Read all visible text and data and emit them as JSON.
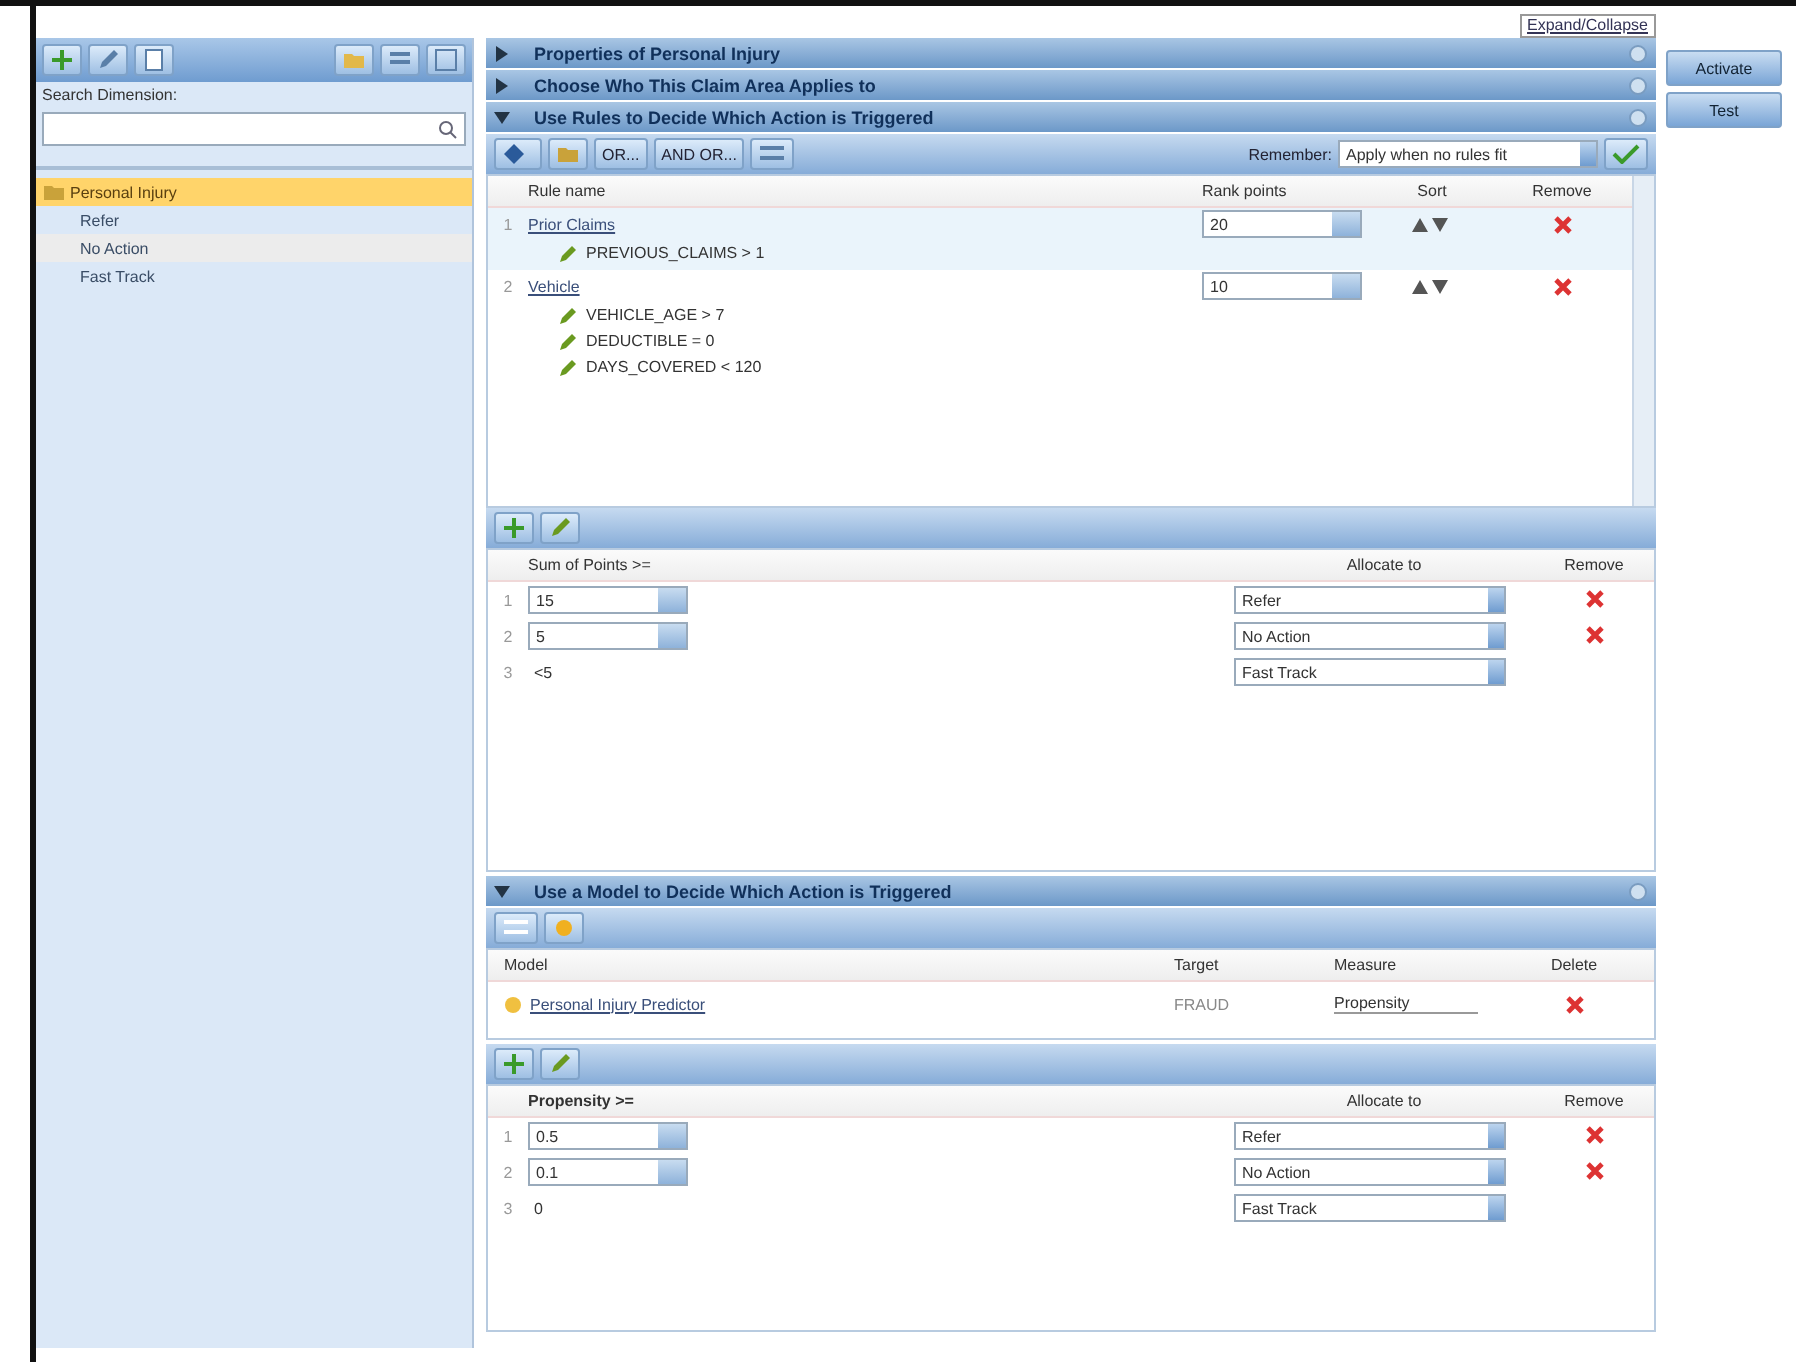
{
  "top_link": "Expand/Collapse",
  "sidebar": {
    "search_label": "Search Dimension:",
    "tree": [
      {
        "label": "Personal Injury",
        "selected": true,
        "highlighted": false,
        "children": [
          {
            "label": "Refer",
            "selected": false,
            "highlighted": false
          },
          {
            "label": "No Action",
            "selected": false,
            "highlighted": true
          },
          {
            "label": "Fast Track",
            "selected": false,
            "highlighted": false
          }
        ]
      }
    ]
  },
  "sections": [
    {
      "title": "Properties of Personal Injury",
      "expanded": false
    },
    {
      "title": "Choose Who This Claim Area Applies to",
      "expanded": false
    },
    {
      "kind": "rules",
      "title": "Use Rules to Decide Which Action is Triggered",
      "expanded": true,
      "toolbar": {
        "buttons": [
          "OR...",
          "AND OR..."
        ],
        "remember_label": "Remember:",
        "remember_value": "Apply when no rules fit"
      },
      "columns": [
        "Rule name",
        "Rank points",
        "Sort",
        "Remove"
      ],
      "rules": [
        {
          "number": "1",
          "name": "Prior Claims",
          "points": "20",
          "conditions": [
            "PREVIOUS_CLAIMS > 1"
          ]
        },
        {
          "number": "2",
          "name": "Vehicle",
          "points": "10",
          "conditions": [
            "VEHICLE_AGE > 7",
            "DEDUCTIBLE = 0",
            "DAYS_COVERED < 120"
          ]
        }
      ],
      "allocation": {
        "columns": [
          "Sum of Points >=",
          "Allocate to",
          "Remove"
        ],
        "rows": [
          {
            "number": "1",
            "threshold": "15",
            "editable": true,
            "allocate": "Refer",
            "removable": true
          },
          {
            "number": "2",
            "threshold": "5",
            "editable": true,
            "allocate": "No Action",
            "removable": true
          },
          {
            "number": "3",
            "threshold": "<5",
            "editable": false,
            "allocate": "Fast Track",
            "removable": false
          }
        ]
      }
    },
    {
      "kind": "model",
      "title": "Use a Model to Decide Which Action is Triggered",
      "expanded": true,
      "columns": [
        "Model",
        "Target",
        "Measure",
        "Delete"
      ],
      "models": [
        {
          "name": "Personal Injury Predictor",
          "target": "FRAUD",
          "measure": "Propensity"
        }
      ],
      "allocation": {
        "columns": [
          "Propensity >=",
          "Allocate to",
          "Remove"
        ],
        "rows": [
          {
            "number": "1",
            "threshold": "0.5",
            "editable": true,
            "allocate": "Refer",
            "removable": true
          },
          {
            "number": "2",
            "threshold": "0.1",
            "editable": true,
            "allocate": "No Action",
            "removable": true
          },
          {
            "number": "3",
            "threshold": "0",
            "editable": false,
            "allocate": "Fast Track",
            "removable": false
          }
        ]
      }
    }
  ],
  "action_buttons": [
    "Activate",
    "Test"
  ]
}
